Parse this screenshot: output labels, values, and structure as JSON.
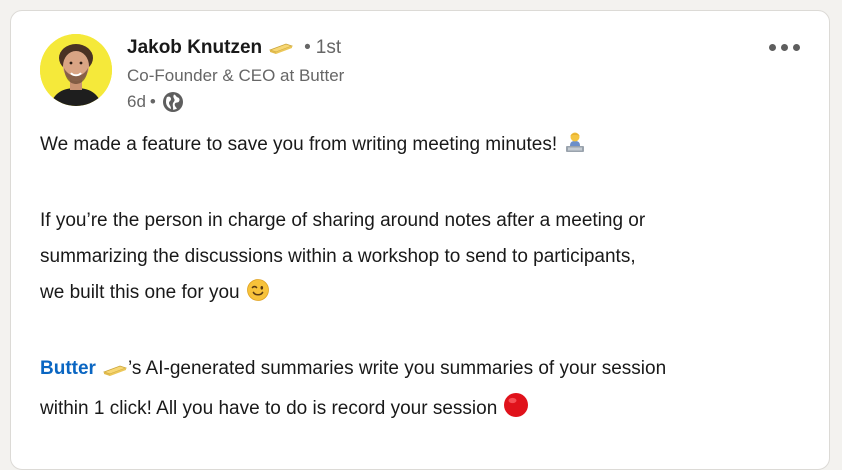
{
  "post": {
    "author": {
      "name": "Jakob Knutzen",
      "name_emoji": "butter-emoji",
      "degree_separator": "•",
      "connection_degree": "1st",
      "headline": "Co-Founder & CEO at Butter",
      "time_ago": "6d",
      "time_separator": "•",
      "visibility_icon": "globe-icon"
    },
    "menu_icon": "more-horizontal-icon",
    "body": {
      "paragraph_1": "We made a feature to save you from writing meeting minutes!",
      "paragraph_1_emoji": "technologist-emoji",
      "paragraph_2_line_1": "If you’re the person in charge of sharing around notes after a meeting or",
      "paragraph_2_line_2": "summarizing the discussions within a workshop to send to participants,",
      "paragraph_2_line_3": "we built this one for you",
      "paragraph_2_emoji": "winking-face-emoji",
      "mention": "Butter",
      "mention_emoji": "butter-emoji",
      "paragraph_3_rest": "’s AI-generated summaries write you summaries of your session",
      "paragraph_3_line_2": "within 1 click! All you have to do is record your session",
      "paragraph_3_emoji": "red-circle-emoji"
    },
    "colors": {
      "link": "#0a66c2",
      "text": "#191919",
      "muted": "#666666",
      "avatar_bg": "#f5e93a",
      "record_red": "#e0121b"
    }
  }
}
